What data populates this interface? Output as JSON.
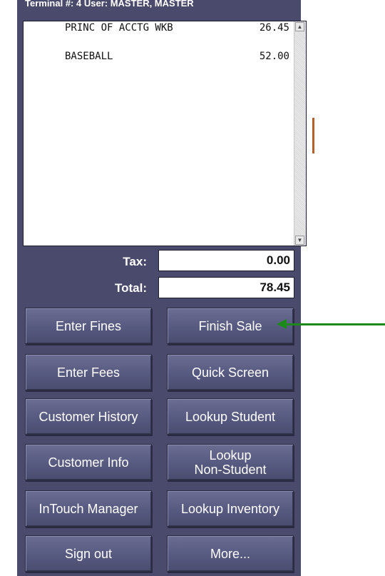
{
  "header": {
    "status": "Terminal #: 4   User: MASTER, MASTER"
  },
  "receipt": {
    "items": [
      {
        "name": "PRINC OF ACCTG WKB",
        "price": "26.45"
      },
      {
        "name": "BASEBALL",
        "price": "52.00"
      }
    ]
  },
  "totals": {
    "tax_label": "Tax:",
    "tax_value": "0.00",
    "total_label": "Total:",
    "total_value": "78.45"
  },
  "buttons": {
    "enter_fines": "Enter Fines",
    "finish_sale": "Finish Sale",
    "enter_fees": "Enter Fees",
    "quick_screen": "Quick Screen",
    "customer_history": "Customer History",
    "lookup_student": "Lookup Student",
    "customer_info": "Customer Info",
    "lookup_non_student": "Lookup\nNon-Student",
    "intouch_manager": "InTouch Manager",
    "lookup_inventory": "Lookup Inventory",
    "sign_out": "Sign out",
    "more": "More..."
  },
  "colors": {
    "panel": "#4a4a6c",
    "annotation_arrow": "#1b8a1b"
  },
  "icons": {
    "scroll_up": "scroll-up-arrow-icon",
    "scroll_down": "scroll-down-arrow-icon",
    "annotation": "pointer-arrow-icon"
  }
}
